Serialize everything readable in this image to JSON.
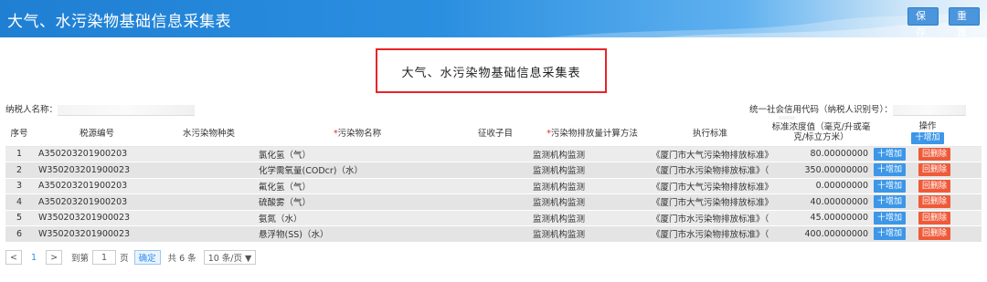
{
  "header": {
    "title": "大气、水污染物基础信息采集表",
    "save_label": "保存",
    "reset_label": "重置"
  },
  "form_title": "大气、水污染物基础信息采集表",
  "meta": {
    "taxpayer_label": "纳税人名称：",
    "credit_code_label": "统一社会信用代码（纳税人识别号）："
  },
  "table": {
    "columns": [
      "序号",
      "税源编号",
      "水污染物种类",
      "污染物名称",
      "征收子目",
      "污染物排放量计算方法",
      "执行标准",
      "标准浓度值（毫克/升或毫克/标立方米）",
      "操作"
    ],
    "required_mark": "*",
    "header_add": "十增加",
    "add_label": "十增加",
    "delete_label": "回删除",
    "rows": [
      {
        "no": "1",
        "code": "A350203201900203",
        "water_type": "",
        "name": "氯化氢（气）",
        "sub_item": "",
        "method": "监测机构监测",
        "standard": "《厦门市大气污染物排放标准》",
        "value": "80.00000000"
      },
      {
        "no": "2",
        "code": "W350203201900023",
        "water_type": "",
        "name": "化学需氧量(CODcr)（水）",
        "sub_item": "",
        "method": "监测机构监测",
        "standard": "《厦门市水污染物排放标准》（",
        "value": "350.00000000"
      },
      {
        "no": "3",
        "code": "A350203201900203",
        "water_type": "",
        "name": "氟化氢（气）",
        "sub_item": "",
        "method": "监测机构监测",
        "standard": "《厦门市大气污染物排放标准》",
        "value": "0.00000000"
      },
      {
        "no": "4",
        "code": "A350203201900203",
        "water_type": "",
        "name": "硫酸雾（气）",
        "sub_item": "",
        "method": "监测机构监测",
        "standard": "《厦门市大气污染物排放标准》",
        "value": "40.00000000"
      },
      {
        "no": "5",
        "code": "W350203201900023",
        "water_type": "",
        "name": "氨氮（水）",
        "sub_item": "",
        "method": "监测机构监测",
        "standard": "《厦门市水污染物排放标准》（",
        "value": "45.00000000"
      },
      {
        "no": "6",
        "code": "W350203201900023",
        "water_type": "",
        "name": "悬浮物(SS)（水）",
        "sub_item": "",
        "method": "监测机构监测",
        "standard": "《厦门市水污染物排放标准》（",
        "value": "400.00000000"
      }
    ]
  },
  "pagination": {
    "prev": "<",
    "current": "1",
    "next": ">",
    "goto_label": "到第",
    "page_input": "1",
    "page_unit": "页",
    "confirm": "确定",
    "total": "共 6 条",
    "page_size": "10 条/页 ▼"
  }
}
